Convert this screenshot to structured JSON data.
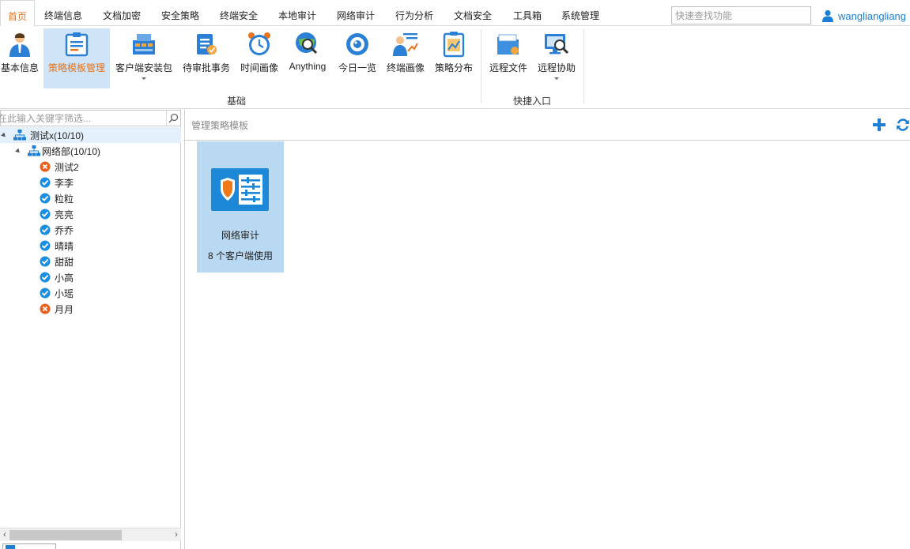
{
  "menu": {
    "tabs": [
      "首页",
      "终端信息",
      "文档加密",
      "安全策略",
      "终端安全",
      "本地审计",
      "网络审计",
      "行为分析",
      "文档安全",
      "工具箱",
      "系统管理"
    ],
    "active_tab": "首页",
    "search_placeholder": "快速查找功能",
    "username": "wangliangliang"
  },
  "ribbon": {
    "buttons": [
      {
        "label": "基本信息",
        "icon": "user-info-icon"
      },
      {
        "label": "策略模板管理",
        "icon": "template-icon",
        "active": true
      },
      {
        "label": "客户端安装包",
        "icon": "package-icon",
        "has_dropdown": true
      },
      {
        "label": "待审批事务",
        "icon": "approval-icon"
      },
      {
        "label": "时间画像",
        "icon": "clock-icon"
      },
      {
        "label": "Anything",
        "icon": "globe-search-icon"
      },
      {
        "label": "今日一览",
        "icon": "eye-icon"
      },
      {
        "label": "终端画像",
        "icon": "terminal-portrait-icon"
      },
      {
        "label": "策略分布",
        "icon": "chart-icon"
      },
      {
        "label": "远程文件",
        "icon": "remote-file-icon"
      },
      {
        "label": "远程协助",
        "icon": "remote-assist-icon",
        "has_dropdown": true
      }
    ],
    "groups": [
      "基础",
      "快捷入口"
    ]
  },
  "tree": {
    "filter_placeholder": "在此输入关键字筛选...",
    "root": "测试x(10/10)",
    "department": "网络部(10/10)",
    "users": [
      {
        "name": "测试2",
        "status": "offline"
      },
      {
        "name": "李李",
        "status": "online"
      },
      {
        "name": "粒粒",
        "status": "online"
      },
      {
        "name": "亮亮",
        "status": "online"
      },
      {
        "name": "乔乔",
        "status": "online"
      },
      {
        "name": "晴晴",
        "status": "online"
      },
      {
        "name": "甜甜",
        "status": "online"
      },
      {
        "name": "小高",
        "status": "online"
      },
      {
        "name": "小瑶",
        "status": "online"
      },
      {
        "name": "月月",
        "status": "offline"
      }
    ]
  },
  "main": {
    "title": "管理策略模板",
    "templates": [
      {
        "name": "网络审计",
        "usage": "8 个客户端使用",
        "icon": "shield-settings-icon"
      }
    ]
  },
  "colors": {
    "accent": "#e8731a",
    "brand_blue": "#1e7fd2",
    "online": "#1a8ee0",
    "offline": "#e8601c",
    "card_bg": "#b9d9f2"
  }
}
